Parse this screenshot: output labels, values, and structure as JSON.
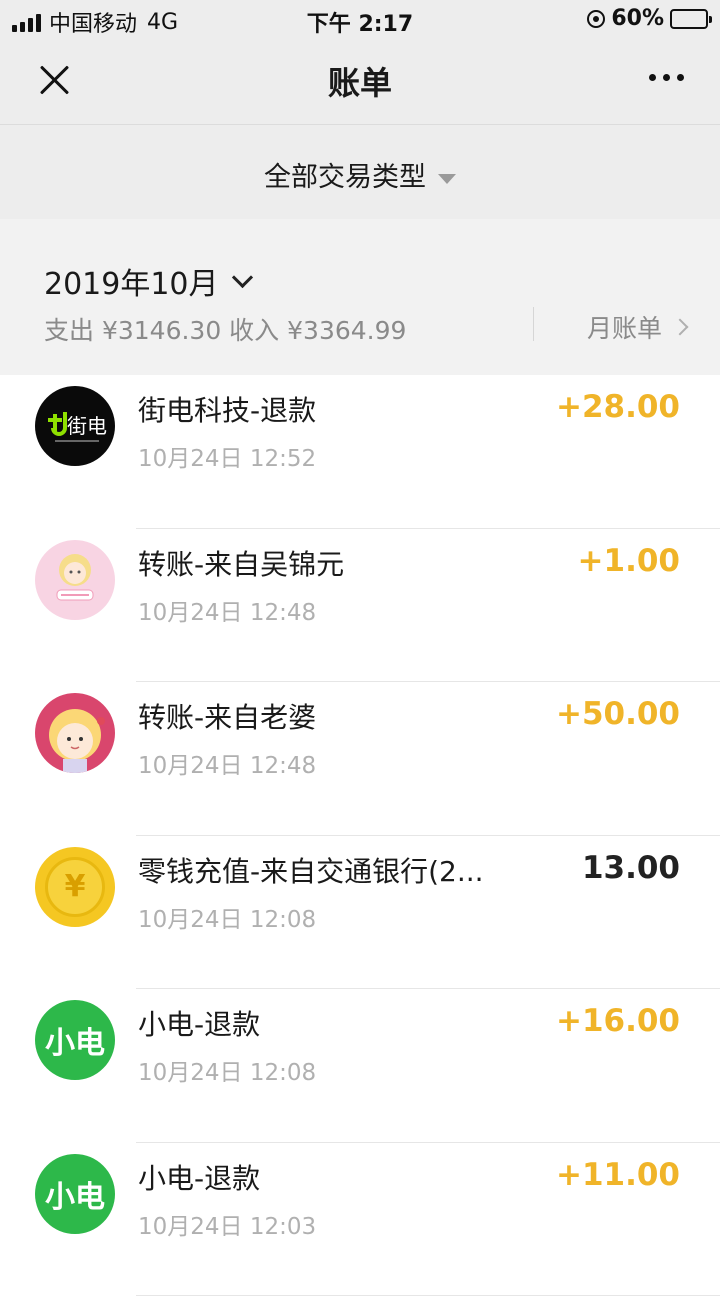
{
  "status_bar": {
    "carrier": "中国移动",
    "network": "4G",
    "time": "下午 2:17",
    "battery_percent": "60%",
    "battery_level": 0.6
  },
  "nav": {
    "title": "账单",
    "close_icon": "close-icon",
    "more_icon": "more-icon"
  },
  "filter": {
    "label": "全部交易类型"
  },
  "month": {
    "title": "2019年10月",
    "summary": "支出 ¥3146.30 收入 ¥3364.99",
    "month_bill_label": "月账单"
  },
  "transactions": [
    {
      "title": "街电科技-退款",
      "time": "10月24日 12:52",
      "amount": "+28.00",
      "type": "income",
      "avatar": "jiedian-logo",
      "avatar_text": "街电"
    },
    {
      "title": "转账-来自吴锦元",
      "time": "10月24日 12:48",
      "amount": "+1.00",
      "type": "income",
      "avatar": "pink-girl-avatar",
      "avatar_text": ""
    },
    {
      "title": "转账-来自老婆",
      "time": "10月24日 12:48",
      "amount": "+50.00",
      "type": "income",
      "avatar": "cartoon-girl-avatar",
      "avatar_text": ""
    },
    {
      "title": "零钱充值-来自交通银行(2...",
      "time": "10月24日 12:08",
      "amount": "13.00",
      "type": "neutral",
      "avatar": "yuan-coin-icon",
      "avatar_text": "¥"
    },
    {
      "title": "小电-退款",
      "time": "10月24日 12:08",
      "amount": "+16.00",
      "type": "income",
      "avatar": "xiaodian-logo",
      "avatar_text": "小电"
    },
    {
      "title": "小电-退款",
      "time": "10月24日 12:03",
      "amount": "+11.00",
      "type": "income",
      "avatar": "xiaodian-logo",
      "avatar_text": "小电"
    }
  ],
  "colors": {
    "income": "#f0b429",
    "neutral": "#222222",
    "header_bg": "#ededed"
  }
}
